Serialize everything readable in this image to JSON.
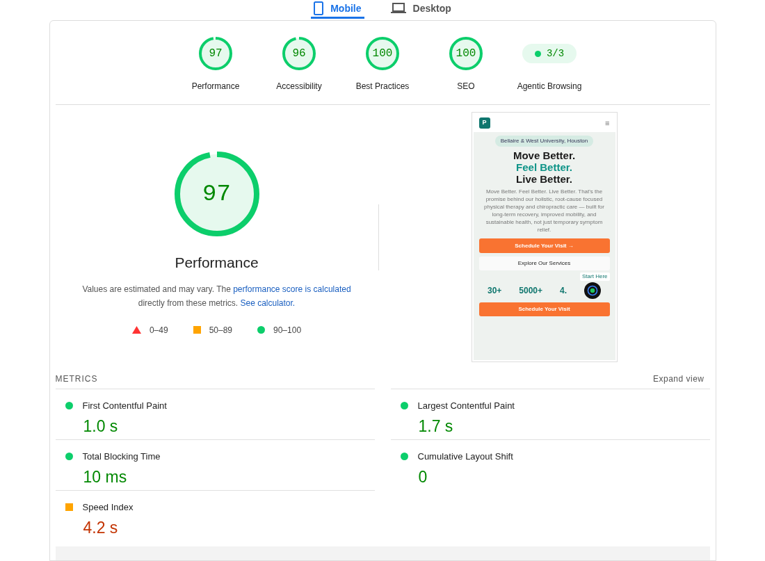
{
  "tabs": [
    {
      "label": "Mobile",
      "selected": true
    },
    {
      "label": "Desktop",
      "selected": false
    }
  ],
  "categories": [
    {
      "kind": "gauge",
      "score": "97",
      "label": "Performance",
      "level": 0.97
    },
    {
      "kind": "gauge",
      "score": "96",
      "label": "Accessibility",
      "level": 0.96
    },
    {
      "kind": "gauge",
      "score": "100",
      "label": "Best Practices",
      "level": 1
    },
    {
      "kind": "gauge",
      "score": "100",
      "label": "SEO",
      "level": 1
    },
    {
      "kind": "pill",
      "score": "3/3",
      "label": "Agentic Browsing"
    }
  ],
  "performance": {
    "score": "97",
    "level": 0.97,
    "title": "Performance",
    "note_before": "Values are estimated and may vary. The ",
    "note_link": "performance score is calculated",
    "note_middle": " directly from these metrics. ",
    "note_link2": "See calculator."
  },
  "legend": [
    {
      "kind": "fail",
      "range": "0–49"
    },
    {
      "kind": "average",
      "range": "50–89"
    },
    {
      "kind": "pass",
      "range": "90–100"
    }
  ],
  "preview": {
    "logo": "P",
    "menu": "≡",
    "location": "Bellaire & West University, Houston",
    "headline": [
      "Move Better.",
      "Feel Better.",
      "Live Better."
    ],
    "body": "Move Better. Feel Better. Live Better. That's the promise behind our holistic, root-cause focused physical therapy and chiropractic care — built for long-term recovery, improved mobility, and sustainable health, not just temporary symptom relief.",
    "primary": "Schedule Your Visit →",
    "secondary": "Explore Our Services",
    "badge": "Start Here",
    "stats": [
      "30+",
      "5000+",
      "4."
    ],
    "sticky": "Schedule Your Visit"
  },
  "metrics_header": {
    "title": "METRICS",
    "action": "Expand view"
  },
  "metrics": [
    {
      "name": "First Contentful Paint",
      "value": "1.0 s",
      "kind": "pass"
    },
    {
      "name": "Largest Contentful Paint",
      "value": "1.7 s",
      "kind": "pass"
    },
    {
      "name": "Total Blocking Time",
      "value": "10 ms",
      "kind": "pass"
    },
    {
      "name": "Cumulative Layout Shift",
      "value": "0",
      "kind": "pass"
    },
    {
      "name": "Speed Index",
      "value": "4.2 s",
      "kind": "average"
    }
  ]
}
